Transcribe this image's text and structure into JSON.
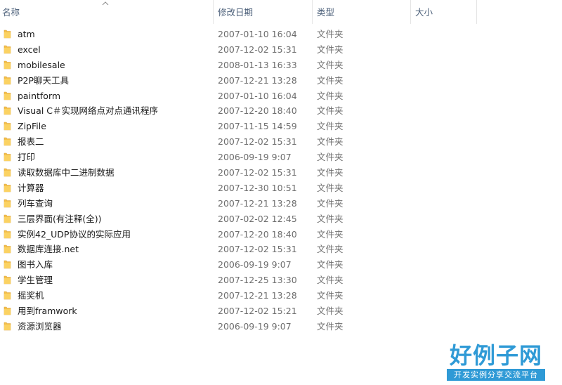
{
  "columns": {
    "name": "名称",
    "date": "修改日期",
    "type": "类型",
    "size": "大小"
  },
  "files": [
    {
      "name": "atm",
      "date": "2007-01-10 16:04",
      "type": "文件夹"
    },
    {
      "name": "excel",
      "date": "2007-12-02 15:31",
      "type": "文件夹"
    },
    {
      "name": "mobilesale",
      "date": "2008-01-13 16:33",
      "type": "文件夹"
    },
    {
      "name": "P2P聊天工具",
      "date": "2007-12-21 13:28",
      "type": "文件夹"
    },
    {
      "name": "paintform",
      "date": "2007-01-10 16:04",
      "type": "文件夹"
    },
    {
      "name": "Visual C＃实现网络点对点通讯程序",
      "date": "2007-12-20 18:40",
      "type": "文件夹"
    },
    {
      "name": "ZipFile",
      "date": "2007-11-15 14:59",
      "type": "文件夹"
    },
    {
      "name": "报表二",
      "date": "2007-12-02 15:31",
      "type": "文件夹"
    },
    {
      "name": "打印",
      "date": "2006-09-19 9:07",
      "type": "文件夹"
    },
    {
      "name": "读取数据库中二进制数据",
      "date": "2007-12-02 15:31",
      "type": "文件夹"
    },
    {
      "name": "计算器",
      "date": "2007-12-30 10:51",
      "type": "文件夹"
    },
    {
      "name": "列车查询",
      "date": "2007-12-21 13:28",
      "type": "文件夹"
    },
    {
      "name": "三层界面(有注释(全))",
      "date": "2007-02-02 12:45",
      "type": "文件夹"
    },
    {
      "name": "实例42_UDP协议的实际应用",
      "date": "2007-12-20 18:40",
      "type": "文件夹"
    },
    {
      "name": "数据库连接.net",
      "date": "2007-12-02 15:31",
      "type": "文件夹"
    },
    {
      "name": "图书入库",
      "date": "2006-09-19 9:07",
      "type": "文件夹"
    },
    {
      "name": "学生管理",
      "date": "2007-12-25 13:30",
      "type": "文件夹"
    },
    {
      "name": "摇奖机",
      "date": "2007-12-21 13:28",
      "type": "文件夹"
    },
    {
      "name": "用到framwork",
      "date": "2007-12-02 15:21",
      "type": "文件夹"
    },
    {
      "name": "资源浏览器",
      "date": "2006-09-19 9:07",
      "type": "文件夹"
    }
  ],
  "icons": {
    "folder": "folder-icon",
    "sort": "sort-up-icon"
  },
  "colors": {
    "header_text": "#4c607a",
    "folder": "#f5c04a",
    "watermark": "#2f9ad6"
  },
  "watermark": {
    "title": "好例子网",
    "subtitle": "开发实例分享交流平台"
  }
}
